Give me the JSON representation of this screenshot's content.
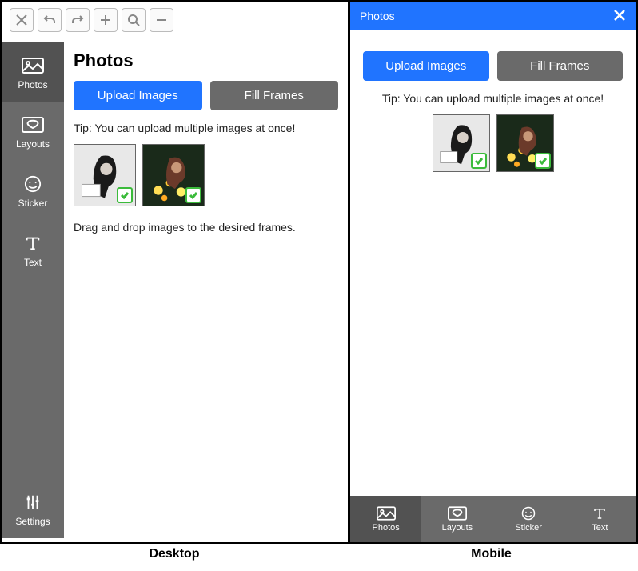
{
  "captions": {
    "desktop": "Desktop",
    "mobile": "Mobile"
  },
  "toolbar_icons": [
    "close",
    "undo",
    "redo",
    "add",
    "search",
    "remove"
  ],
  "nav": {
    "photos": "Photos",
    "layouts": "Layouts",
    "sticker": "Sticker",
    "text": "Text",
    "settings": "Settings"
  },
  "panel": {
    "title": "Photos",
    "upload_label": "Upload Images",
    "fill_label": "Fill Frames",
    "tip": "Tip: You can upload multiple images at once!",
    "drag_hint": "Drag and drop images to the desired frames."
  },
  "mobile": {
    "header_title": "Photos"
  }
}
